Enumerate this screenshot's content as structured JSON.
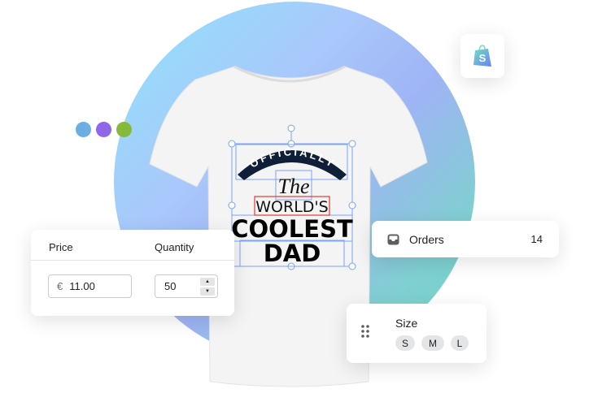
{
  "colors": {
    "dots": [
      "#6aaee3",
      "#8f67e8",
      "#86b83a"
    ],
    "selection": "#7aa2f7",
    "highlight": "#e53935"
  },
  "shirt_design": {
    "line1": "OFFICIALLY",
    "line2": "The",
    "line3": "WORLD'S",
    "line4": "COOLEST",
    "line5": "DAD"
  },
  "shopify": {
    "icon": "shopify-bag-icon"
  },
  "pricing_card": {
    "price_label": "Price",
    "quantity_label": "Quantity",
    "currency": "€",
    "price_value": "11.00",
    "quantity_value": "50"
  },
  "orders_card": {
    "icon": "inbox-icon",
    "label": "Orders",
    "count": "14"
  },
  "size_card": {
    "icon": "drag-handle-icon",
    "label": "Size",
    "options": [
      "S",
      "M",
      "L"
    ]
  }
}
